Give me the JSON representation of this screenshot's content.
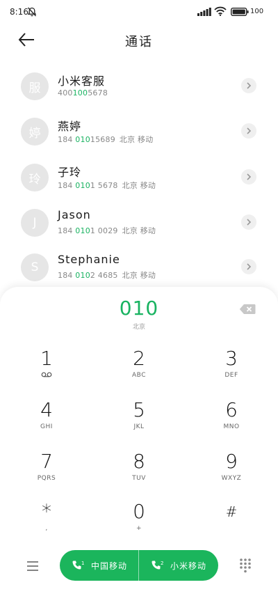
{
  "status_bar": {
    "time": "8:16",
    "battery_text": "100",
    "icons": [
      "bell-off-icon",
      "signal-icon",
      "wifi-icon",
      "battery-icon"
    ]
  },
  "header": {
    "title": "通话",
    "back_icon": "arrow-left-icon"
  },
  "contacts": [
    {
      "avatar": "服",
      "name": "小米客服",
      "number_pre": "400",
      "number_hl": "100",
      "number_post": "5678",
      "location": ""
    },
    {
      "avatar": "婷",
      "name": "燕婷",
      "number_pre": "184 ",
      "number_hl": "010",
      "number_post": "15689",
      "location": "北京 移动"
    },
    {
      "avatar": "玲",
      "name": "子玲",
      "number_pre": "184 ",
      "number_hl": "010",
      "number_post": "1 5678",
      "location": "北京 移动"
    },
    {
      "avatar": "J",
      "name": "Jason",
      "number_pre": "184 ",
      "number_hl": "010",
      "number_post": "1 0029",
      "location": "北京 移动"
    },
    {
      "avatar": "S",
      "name": "Stephanie",
      "number_pre": "184 ",
      "number_hl": "010",
      "number_post": "2 4685",
      "location": "北京 移动"
    }
  ],
  "dial": {
    "number": "010",
    "location": "北京"
  },
  "keypad": [
    {
      "digit": "1",
      "letters": ""
    },
    {
      "digit": "2",
      "letters": "ABC"
    },
    {
      "digit": "3",
      "letters": "DEF"
    },
    {
      "digit": "4",
      "letters": "GHI"
    },
    {
      "digit": "5",
      "letters": "JKL"
    },
    {
      "digit": "6",
      "letters": "MNO"
    },
    {
      "digit": "7",
      "letters": "PQRS"
    },
    {
      "digit": "8",
      "letters": "TUV"
    },
    {
      "digit": "9",
      "letters": "WXYZ"
    },
    {
      "digit": "*",
      "letters": ","
    },
    {
      "digit": "0",
      "letters": "+"
    },
    {
      "digit": "#",
      "letters": ""
    }
  ],
  "bottom": {
    "call_sim1": "中国移动",
    "call_sim2": "小米移动",
    "sim1_badge": "1",
    "sim2_badge": "2"
  },
  "colors": {
    "accent": "#19b361",
    "call_button": "#1bb55c"
  }
}
